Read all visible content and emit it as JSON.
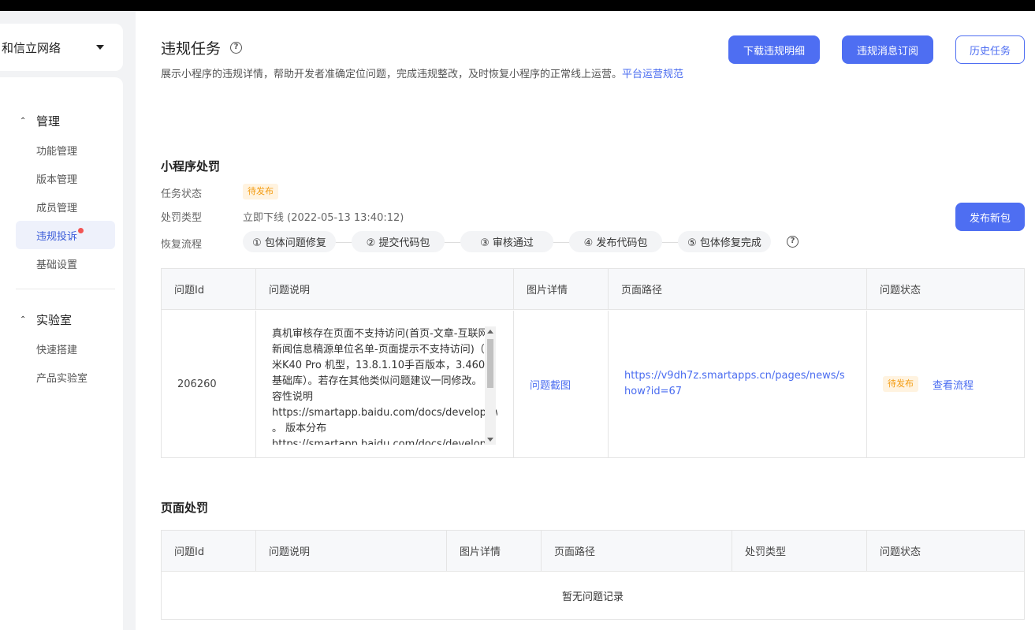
{
  "sidebar": {
    "app_name": "和信立网络",
    "groups": [
      {
        "label": "管理",
        "items": [
          "功能管理",
          "版本管理",
          "成员管理",
          "违规投诉",
          "基础设置"
        ]
      },
      {
        "label": "实验室",
        "items": [
          "快速搭建",
          "产品实验室"
        ]
      }
    ],
    "active_item": "违规投诉"
  },
  "header": {
    "title": "违规任务",
    "description": "展示小程序的违规详情，帮助开发者准确定位问题，完成违规整改，及时恢复小程序的正常线上运营。",
    "description_link": "平台运营规范",
    "buttons": {
      "download": "下载违规明细",
      "subscribe": "违规消息订阅",
      "history": "历史任务"
    }
  },
  "app_penalty": {
    "title": "小程序处罚",
    "status_label": "任务状态",
    "status_value": "待发布",
    "type_label": "处罚类型",
    "type_value": "立即下线 (2022-05-13 13:40:12)",
    "flow_label": "恢复流程",
    "steps": [
      "① 包体问题修复",
      "② 提交代码包",
      "③ 审核通过",
      "④ 发布代码包",
      "⑤ 包体修复完成"
    ],
    "publish_button": "发布新包",
    "columns": [
      "问题Id",
      "问题说明",
      "图片详情",
      "页面路径",
      "问题状态"
    ],
    "row": {
      "id": "206260",
      "description": "真机审核存在页面不支持访问(首页-文章-互联网新闻信息稿源单位名单-页面提示不支持访问)（红米K40 Pro 机型，13.8.1.10手百版本，3.460.6基础库）。若存在其他类似问题建议一同修改。 兼容性说明 https://smartapp.baidu.com/docs/develop/swan/compatibility/ 。 版本分布 https://smartapp.baidu.com/docs/develop/",
      "image_link": "问题截图",
      "path": "https://v9dh7z.smartapps.cn/pages/news/show?id=67",
      "status": "待发布",
      "action": "查看流程"
    }
  },
  "page_penalty": {
    "title": "页面处罚",
    "columns": [
      "问题Id",
      "问题说明",
      "图片详情",
      "页面路径",
      "处罚类型",
      "问题状态"
    ],
    "empty_text": "暂无问题记录"
  },
  "colors": {
    "primary": "#4e6ef2",
    "pending_bg": "#fff3e0",
    "pending_text": "#f39c12",
    "notice_dot": "#f25454"
  }
}
